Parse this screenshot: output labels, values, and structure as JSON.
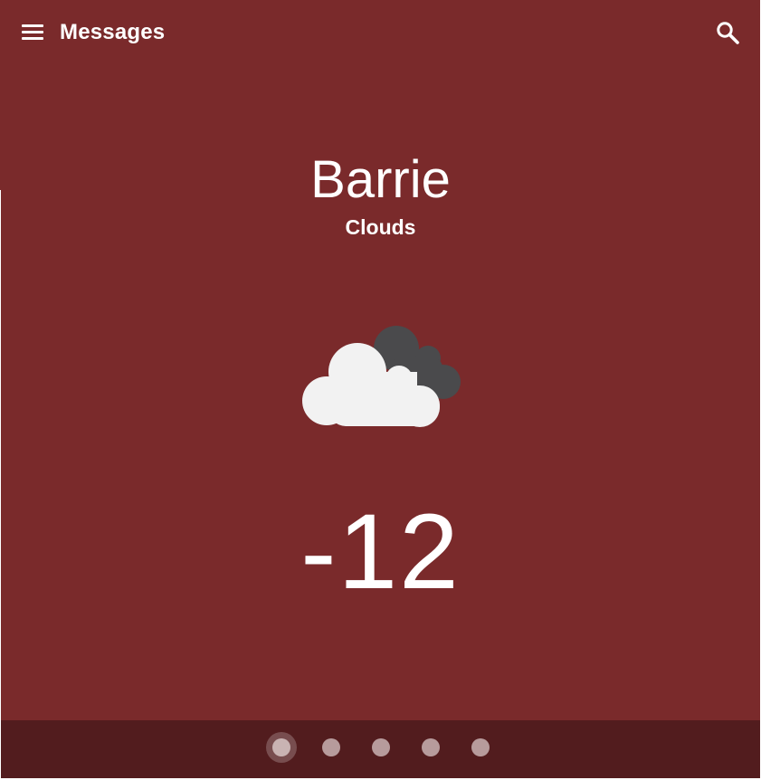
{
  "toolbar": {
    "title": "Messages",
    "menu_icon": "hamburger-menu-icon",
    "search_icon": "search-icon"
  },
  "weather": {
    "city": "Barrie",
    "condition": "Clouds",
    "icon": "clouds-icon",
    "temperature": "-12"
  },
  "pager": {
    "page_count": 5,
    "active_index": 0
  },
  "colors": {
    "background": "#7a2a2b",
    "pager_bar": "#521c1e",
    "text": "#ffffff",
    "cloud_front": "#f2f2f2",
    "cloud_back": "#4a4a4c",
    "dot": "#b79b9c"
  }
}
